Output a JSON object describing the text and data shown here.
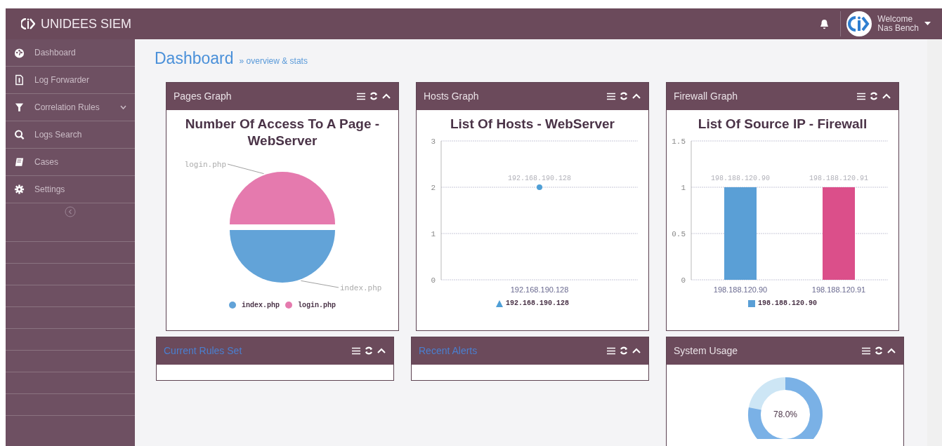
{
  "brand": {
    "name": "UNIDEES SIEM"
  },
  "user": {
    "greeting": "Welcome",
    "name": "Nas Bench"
  },
  "sidebar": {
    "items": [
      {
        "label": "Dashboard",
        "expandable": false
      },
      {
        "label": "Log Forwarder",
        "expandable": false
      },
      {
        "label": "Correlation Rules",
        "expandable": true
      },
      {
        "label": "Logs Search",
        "expandable": false
      },
      {
        "label": "Cases",
        "expandable": false
      },
      {
        "label": "Settings",
        "expandable": false
      }
    ]
  },
  "page": {
    "title": "Dashboard",
    "subtitle": "» overview & stats"
  },
  "panels": [
    {
      "title": "Pages Graph",
      "kind": "chart",
      "link": false,
      "chart_data": {
        "type": "pie",
        "title": "Number Of Access To A Page - WebServer",
        "categories": [
          "index.php",
          "login.php"
        ],
        "values": [
          50,
          50
        ],
        "colors": [
          "#62a3d8",
          "#e57aae"
        ],
        "legend": "bottom"
      }
    },
    {
      "title": "Hosts Graph",
      "kind": "chart",
      "link": false,
      "chart_data": {
        "type": "line",
        "title": "List Of Hosts - WebServer",
        "categories": [
          "192.168.190.128"
        ],
        "series": [
          {
            "name": "192.168.190.128",
            "color": "#4f9fd6",
            "marker": "circle",
            "values": [
              2
            ]
          }
        ],
        "ylim": [
          0,
          3
        ],
        "yticks": [
          0,
          1,
          2,
          3
        ],
        "value_labels": [
          "192.168.190.128"
        ],
        "legend": "bottom"
      }
    },
    {
      "title": "Firewall Graph",
      "kind": "chart",
      "link": false,
      "chart_data": {
        "type": "bar",
        "title": "List Of Source IP - Firewall",
        "categories": [
          "198.188.120.90",
          "198.188.120.91"
        ],
        "series": [
          {
            "name": "198.188.120.90",
            "color": "#5a9fd6",
            "values": [
              1,
              null
            ]
          },
          {
            "color": "#db4f8a",
            "values": [
              null,
              1
            ]
          }
        ],
        "ylim": [
          0,
          1.5
        ],
        "yticks": [
          0,
          0.5,
          1,
          1.5
        ],
        "value_labels": [
          "198.188.120.90",
          "198.188.120.91"
        ],
        "legend": "bottom"
      }
    },
    {
      "title": "Current Rules Set",
      "kind": "empty",
      "link": true
    },
    {
      "title": "Recent Alerts",
      "kind": "empty",
      "link": true
    },
    {
      "title": "System Usage",
      "kind": "donut",
      "link": false,
      "reading": "78.0%"
    }
  ]
}
